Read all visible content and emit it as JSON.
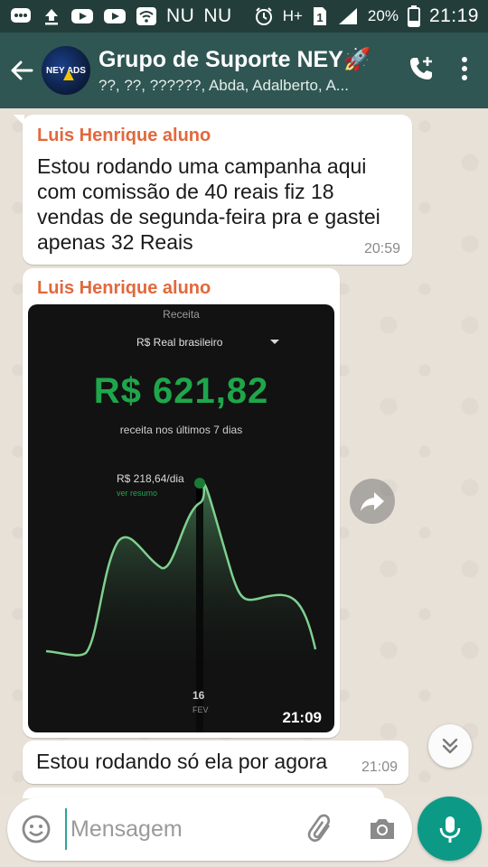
{
  "status_bar": {
    "carrier_1": "NU",
    "carrier_2": "NU",
    "network": "H+",
    "sim_slot": "1",
    "battery": "20%",
    "clock": "21:19",
    "icons": [
      "whatsapp-message-icon",
      "upload-icon",
      "youtube-icon",
      "youtube-icon",
      "wifi-icon",
      "alarm-icon",
      "signal-icon",
      "battery-icon"
    ]
  },
  "header": {
    "title": "Grupo de Suporte NEY🚀",
    "members": "??, ??, ??????, Abda, Adalberto, A...",
    "avatar_text": "NEY ADS",
    "actions": [
      "add-call-icon",
      "more-options-icon"
    ]
  },
  "messages": [
    {
      "sender": "Luis Henrique aluno",
      "text": "Estou rodando uma campanha aqui com comissão de 40 reais fiz 18 vendas de segunda-feira pra e gastei apenas 32 Reais",
      "time": "20:59"
    },
    {
      "sender": "Luis Henrique aluno",
      "time": "21:09",
      "image": {
        "label": "Receita",
        "currency": "R$ Real brasileiro",
        "amount": "R$ 621,82",
        "subtitle": "receita nos últimos 7 dias",
        "daily": "R$ 218,64/dia",
        "link": "ver resumo",
        "day": "16",
        "month": "FEV",
        "accent_color": "#1fa64b",
        "line_color": "#7fd08f"
      }
    },
    {
      "text": "Estou rodando só ela por agora",
      "time": "21:09"
    }
  ],
  "composer": {
    "placeholder": "Mensagem",
    "icons": [
      "emoji-icon",
      "attach-icon",
      "camera-icon",
      "mic-icon"
    ]
  },
  "colors": {
    "header": "#2f5652",
    "statusbar": "#233e3a",
    "sender": "#e2683c",
    "mic": "#0c9a87"
  }
}
